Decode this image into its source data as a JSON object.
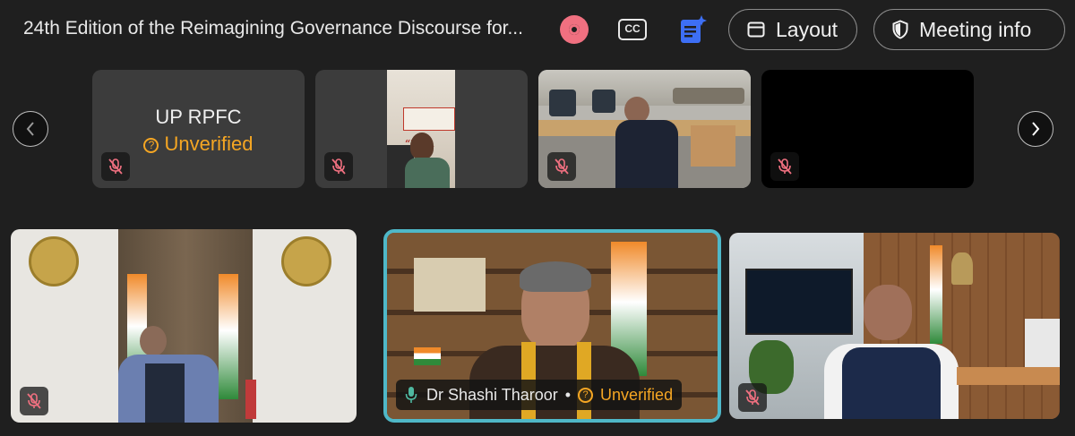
{
  "meeting": {
    "title": "24th Edition of the Reimagining Governance Discourse for..."
  },
  "toolbar": {
    "cc_label": "CC",
    "layout_label": "Layout",
    "meeting_info_label": "Meeting info"
  },
  "participants": [
    {
      "name": "UP RPFC",
      "status": "Unverified",
      "muted": true
    },
    {
      "name": "",
      "muted": true
    },
    {
      "name": "",
      "muted": true
    },
    {
      "name": "",
      "muted": true
    },
    {
      "name": "",
      "muted": true
    },
    {
      "name": "Dr Shashi Tharoor",
      "status": "Unverified",
      "muted": false,
      "speaking": true
    },
    {
      "name": "",
      "muted": true
    }
  ],
  "colors": {
    "background": "#1f1f1f",
    "active_speaker_border": "#4fb8c8",
    "unverified": "#f5a623",
    "record": "#f07080"
  }
}
